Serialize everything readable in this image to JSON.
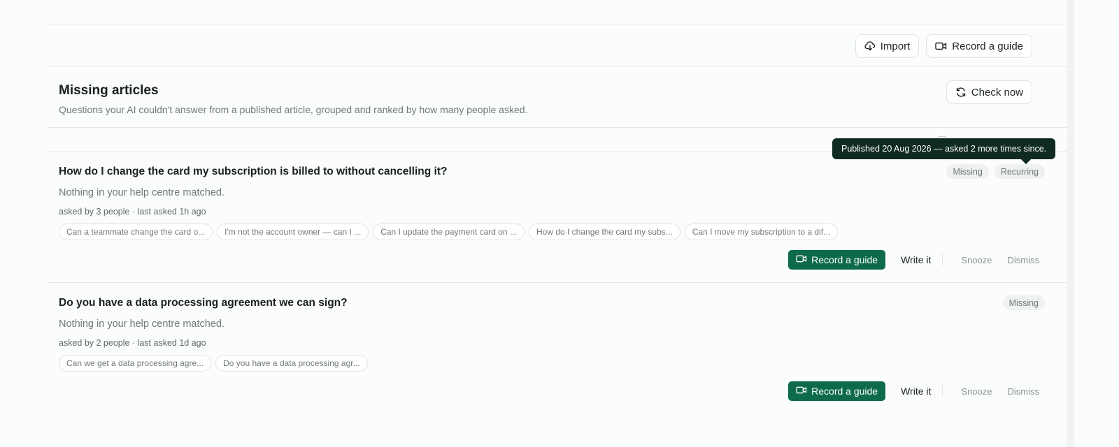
{
  "toolbar": {
    "import_label": "Import",
    "record_label": "Record a guide",
    "import_icon": "cloud-download-icon",
    "record_icon": "video-camera-icon"
  },
  "section": {
    "title": "Missing articles",
    "subtitle": "Questions your AI couldn't answer from a published article, grouped and ranked by how many people asked.",
    "check_now_label": "Check now",
    "check_now_icon": "refresh-icon"
  },
  "tooltip": {
    "text": "Published 20 Aug 2026 — asked 2 more times since."
  },
  "items": [
    {
      "title": "How do I change the card my subscription is billed to without cancelling it?",
      "description": "Nothing in your help centre matched.",
      "meta": "asked by 3 people · last asked 1h ago",
      "badges": [
        "Missing",
        "Recurring"
      ],
      "questions": [
        "Can a teammate change the card o...",
        "I'm not the account owner — can I ...",
        "Can I update the payment card on ...",
        "How do I change the card my subs...",
        "Can I move my subscription to a dif..."
      ],
      "actions": {
        "record": "Record a guide",
        "write": "Write it",
        "snooze": "Snooze",
        "dismiss": "Dismiss"
      }
    },
    {
      "title": "Do you have a data processing agreement we can sign?",
      "description": "Nothing in your help centre matched.",
      "meta": "asked by 2 people · last asked 1d ago",
      "badges": [
        "Missing"
      ],
      "questions": [
        "Can we get a data processing agre...",
        "Do you have a data processing agr..."
      ],
      "actions": {
        "record": "Record a guide",
        "write": "Write it",
        "snooze": "Snooze",
        "dismiss": "Dismiss"
      }
    }
  ],
  "colors": {
    "primary": "#0d6b4a",
    "tooltip_bg": "#0f2a22",
    "badge_bg": "#eef1f0",
    "muted_text": "#6f7a76"
  }
}
